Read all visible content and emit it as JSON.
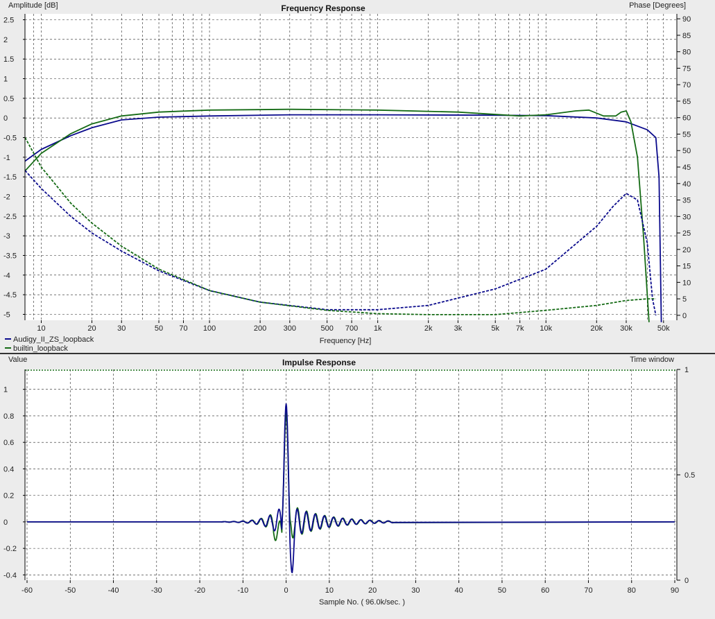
{
  "chart_data": [
    {
      "type": "line",
      "title": "Frequency Response",
      "xlabel": "Frequency [Hz]",
      "ylabel": "Amplitude [dB]",
      "y2label": "Phase [Degrees]",
      "xscale": "log",
      "xlim": [
        8,
        60000
      ],
      "ylim": [
        -5.15,
        2.65
      ],
      "y2lim": [
        -1.5,
        91.5
      ],
      "xticks": [
        10,
        20,
        30,
        50,
        70,
        100,
        200,
        300,
        500,
        700,
        1000,
        2000,
        3000,
        5000,
        7000,
        10000,
        20000,
        30000,
        50000
      ],
      "xtick_labels": [
        "10",
        "20",
        "30",
        "50",
        "70",
        "100",
        "200",
        "300",
        "500",
        "700",
        "1k",
        "2k",
        "3k",
        "5k",
        "7k",
        "10k",
        "20k",
        "30k",
        "50k"
      ],
      "yticks": [
        2.5,
        2,
        1.5,
        1,
        0.5,
        0,
        -0.5,
        -1,
        -1.5,
        -2,
        -2.5,
        -3,
        -3.5,
        -4,
        -4.5,
        -5
      ],
      "y2ticks": [
        90,
        85,
        80,
        75,
        70,
        65,
        60,
        55,
        50,
        45,
        40,
        35,
        30,
        25,
        20,
        15,
        10,
        5,
        0
      ],
      "grid": true,
      "legend": [
        "Audigy_II_ZS_loopback",
        "builtin_loopback"
      ],
      "series": [
        {
          "name": "Audigy_II_ZS_loopback",
          "axis": "amplitude",
          "color": "#0a0a8c",
          "dash": "solid",
          "points": [
            [
              8,
              -1.1
            ],
            [
              10,
              -0.8
            ],
            [
              15,
              -0.45
            ],
            [
              20,
              -0.25
            ],
            [
              30,
              -0.05
            ],
            [
              50,
              0.02
            ],
            [
              100,
              0.05
            ],
            [
              300,
              0.08
            ],
            [
              1000,
              0.08
            ],
            [
              5000,
              0.07
            ],
            [
              10000,
              0.06
            ],
            [
              20000,
              0.0
            ],
            [
              30000,
              -0.1
            ],
            [
              40000,
              -0.3
            ],
            [
              45000,
              -0.5
            ],
            [
              47000,
              -1.5
            ],
            [
              48500,
              -5.2
            ]
          ]
        },
        {
          "name": "builtin_loopback",
          "axis": "amplitude",
          "color": "#156b15",
          "dash": "solid",
          "points": [
            [
              8,
              -1.35
            ],
            [
              10,
              -0.9
            ],
            [
              15,
              -0.4
            ],
            [
              20,
              -0.15
            ],
            [
              30,
              0.05
            ],
            [
              50,
              0.15
            ],
            [
              100,
              0.2
            ],
            [
              300,
              0.22
            ],
            [
              1000,
              0.2
            ],
            [
              3000,
              0.15
            ],
            [
              7000,
              0.05
            ],
            [
              10000,
              0.08
            ],
            [
              15000,
              0.18
            ],
            [
              18000,
              0.2
            ],
            [
              22000,
              0.05
            ],
            [
              26000,
              0.05
            ],
            [
              28000,
              0.15
            ],
            [
              30000,
              0.18
            ],
            [
              32000,
              -0.1
            ],
            [
              35000,
              -1.0
            ],
            [
              38000,
              -3.0
            ],
            [
              41000,
              -5.2
            ]
          ]
        },
        {
          "name": "Audigy_II_ZS_loopback",
          "axis": "phase",
          "color": "#0a0a8c",
          "dash": "dashed",
          "points": [
            [
              8,
              44
            ],
            [
              10,
              38.5
            ],
            [
              15,
              30
            ],
            [
              20,
              25
            ],
            [
              30,
              19.5
            ],
            [
              50,
              13.5
            ],
            [
              100,
              7.5
            ],
            [
              200,
              4
            ],
            [
              500,
              1.7
            ],
            [
              1000,
              1.7
            ],
            [
              2000,
              3
            ],
            [
              5000,
              8
            ],
            [
              10000,
              14
            ],
            [
              20000,
              27
            ],
            [
              25000,
              33
            ],
            [
              30000,
              37
            ],
            [
              35000,
              35
            ],
            [
              40000,
              22
            ],
            [
              43000,
              5
            ],
            [
              45000,
              0
            ]
          ]
        },
        {
          "name": "builtin_loopback",
          "axis": "phase",
          "color": "#156b15",
          "dash": "dashed",
          "points": [
            [
              8,
              54
            ],
            [
              10,
              45
            ],
            [
              15,
              34
            ],
            [
              20,
              28
            ],
            [
              30,
              21
            ],
            [
              50,
              14
            ],
            [
              100,
              7.5
            ],
            [
              200,
              4
            ],
            [
              500,
              1.5
            ],
            [
              1000,
              0.5
            ],
            [
              2000,
              0.2
            ],
            [
              5000,
              0.2
            ],
            [
              10000,
              1.5
            ],
            [
              20000,
              3
            ],
            [
              30000,
              4.5
            ],
            [
              40000,
              5
            ],
            [
              45000,
              5
            ]
          ]
        }
      ]
    },
    {
      "type": "line",
      "title": "Impulse Response",
      "xlabel": "Sample No. ( 96.0k/sec. )",
      "ylabel": "Value",
      "y2label": "Time window",
      "xlim": [
        -60,
        90
      ],
      "ylim": [
        -0.44,
        1.15
      ],
      "y2lim": [
        0,
        1
      ],
      "xticks": [
        -60,
        -50,
        -40,
        -30,
        -20,
        -10,
        0,
        10,
        20,
        30,
        40,
        50,
        60,
        70,
        80,
        90
      ],
      "yticks": [
        1,
        0.8,
        0.6,
        0.4,
        0.2,
        0,
        -0.2,
        -0.4
      ],
      "y2ticks": [
        1,
        0.5,
        0
      ],
      "grid": true,
      "series": [
        {
          "name": "builtin_loopback",
          "color": "#156b15",
          "peak": 0.82,
          "min_before": -0.13,
          "ring_amp": 0.13,
          "start": -15,
          "end": 25
        },
        {
          "name": "Audigy_II_ZS_loopback",
          "color": "#0a0a8c",
          "peak": 0.89,
          "min_after": -0.3,
          "ring_amp": 0.12,
          "start": -15,
          "end": 25
        },
        {
          "name": "time_window",
          "color": "#156b15",
          "dash": "dotted",
          "value": 1
        }
      ]
    }
  ]
}
